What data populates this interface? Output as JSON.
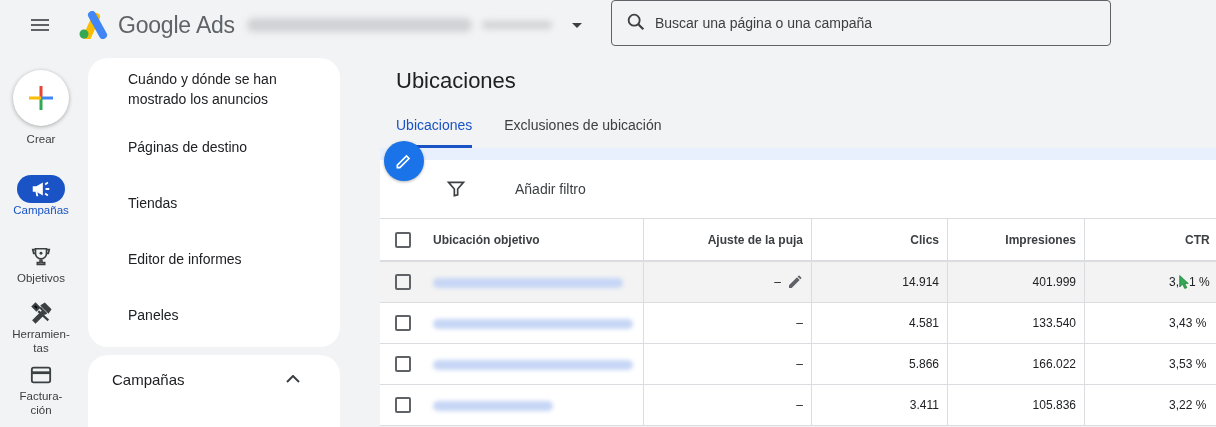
{
  "header": {
    "product": "Google Ads",
    "search": {
      "placeholder": "Buscar una página o una campaña"
    }
  },
  "rail": [
    {
      "label": "Crear",
      "kind": "create",
      "selected": false
    },
    {
      "label": "Campañas",
      "kind": "campaigns",
      "selected": true
    },
    {
      "label": "Objetivos",
      "kind": "goals",
      "selected": false
    },
    {
      "label": "Herramien-tas",
      "kind": "tools",
      "selected": false
    },
    {
      "label": "Factura-ción",
      "kind": "billing",
      "selected": false
    }
  ],
  "nav": {
    "items": [
      "Cuándo y dónde se han mostrado los anuncios",
      "Páginas de destino",
      "Tiendas",
      "Editor de informes",
      "Paneles"
    ],
    "section": {
      "label": "Campañas",
      "expanded": true
    }
  },
  "page": {
    "title": "Ubicaciones",
    "tabs": [
      {
        "label": "Ubicaciones",
        "selected": true
      },
      {
        "label": "Exclusiones de ubicación",
        "selected": false
      }
    ],
    "filter": "Añadir filtro"
  },
  "table": {
    "all_checked": false,
    "columns": [
      "Ubicación objetivo",
      "Ajuste de la puja",
      "Clics",
      "Impresiones",
      "CTR"
    ],
    "rows": [
      {
        "checked": false,
        "highlighted": true,
        "bid": "–",
        "clicks": "14.914",
        "impressions": "401.999",
        "ctr": "3,",
        "ctr_after_cursor": "1 %"
      },
      {
        "checked": false,
        "highlighted": false,
        "bid": "–",
        "clicks": "4.581",
        "impressions": "133.540",
        "ctr": "3,43 %"
      },
      {
        "checked": false,
        "highlighted": false,
        "bid": "–",
        "clicks": "5.866",
        "impressions": "166.022",
        "ctr": "3,53 %"
      },
      {
        "checked": false,
        "highlighted": false,
        "bid": "–",
        "clicks": "3.411",
        "impressions": "105.836",
        "ctr": "3,22 %"
      }
    ]
  }
}
